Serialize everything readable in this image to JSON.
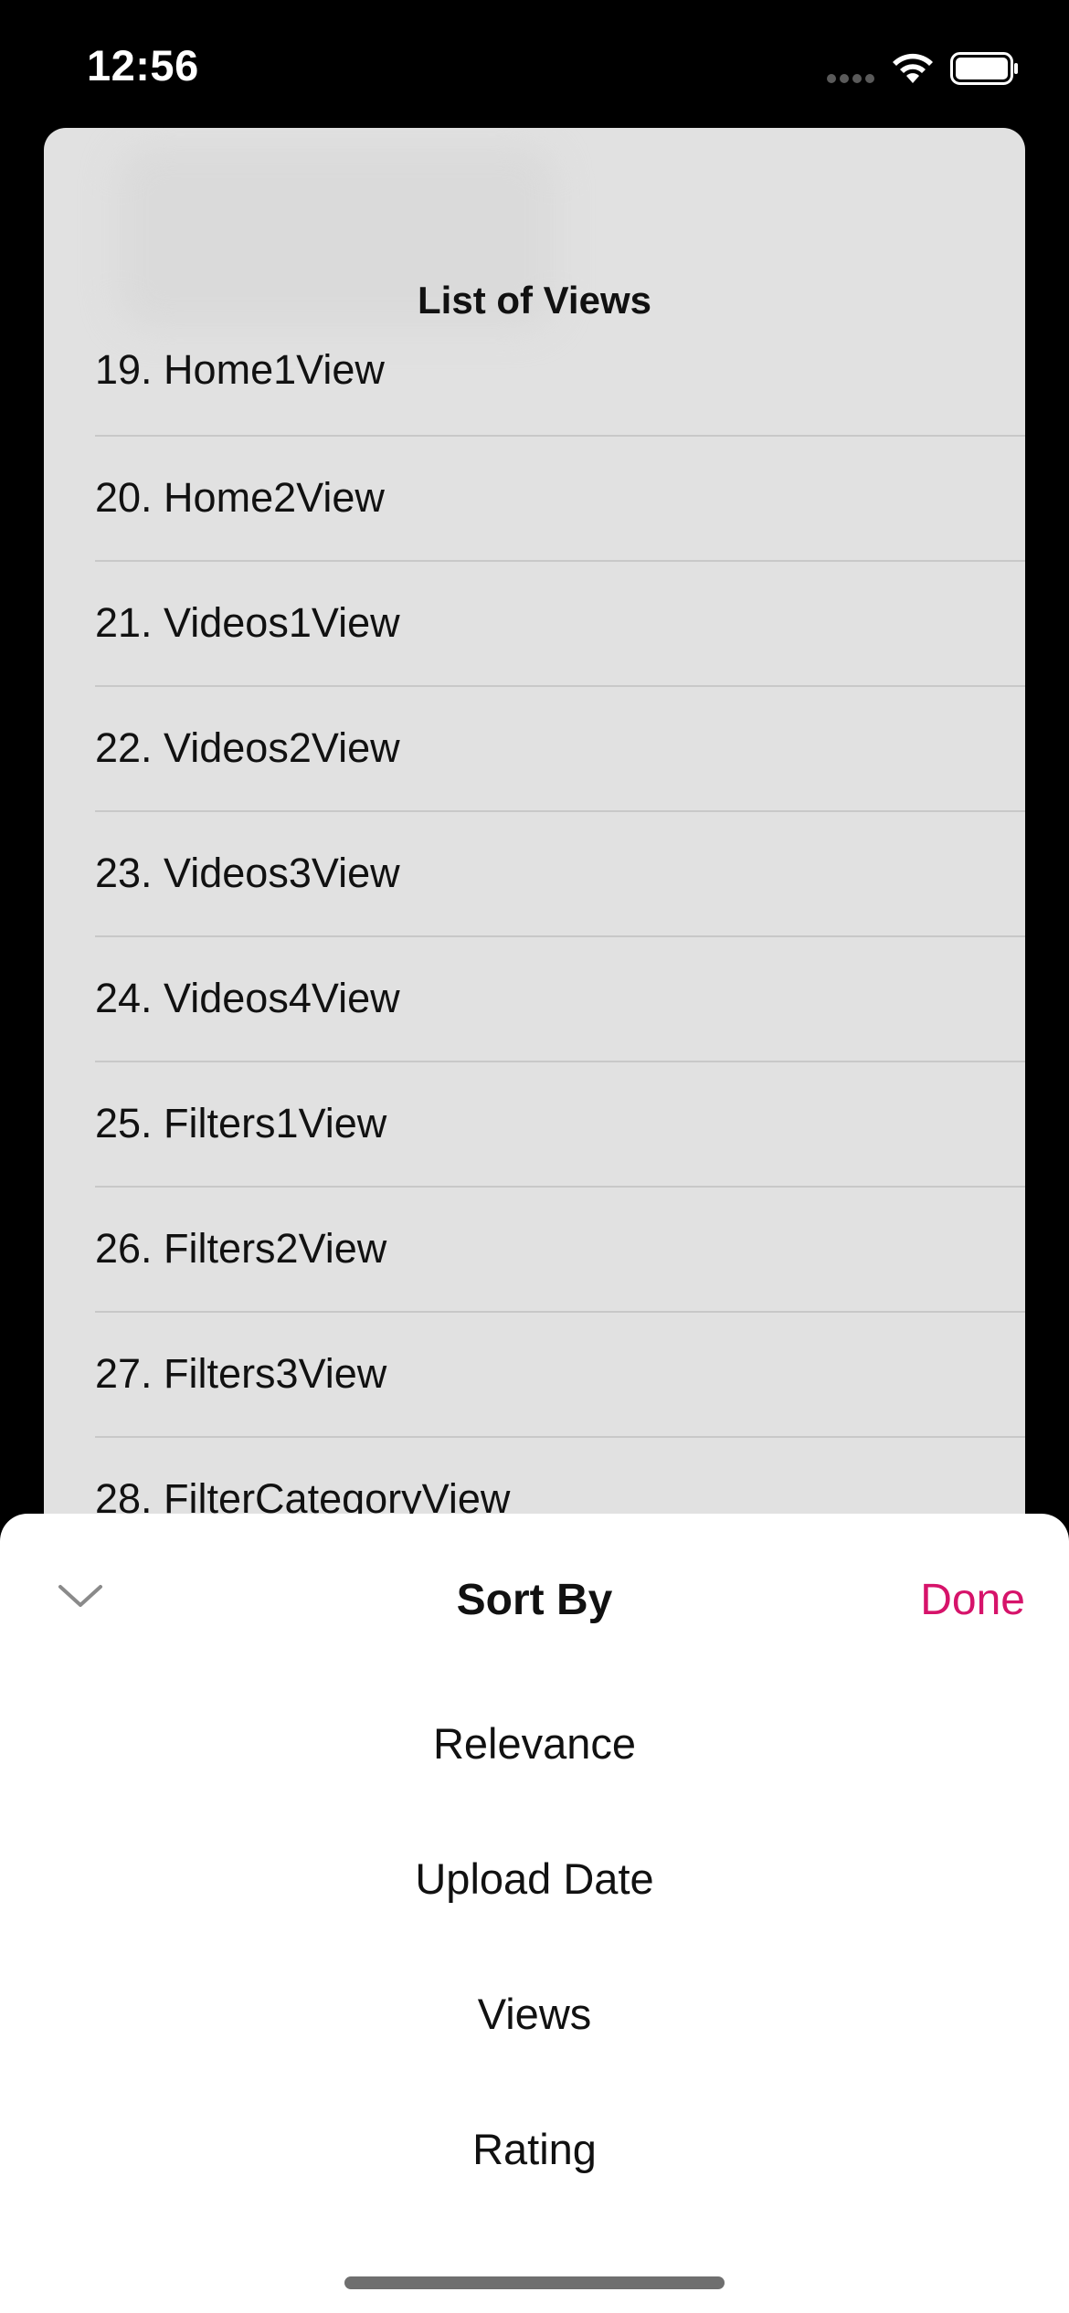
{
  "status_bar": {
    "time": "12:56"
  },
  "background_sheet": {
    "title": "List of Views",
    "items": [
      "19. Home1View",
      "20. Home2View",
      "21. Videos1View",
      "22. Videos2View",
      "23. Videos3View",
      "24. Videos4View",
      "25. Filters1View",
      "26. Filters2View",
      "27. Filters3View",
      "28. FilterCategoryView"
    ]
  },
  "sort_sheet": {
    "title": "Sort By",
    "done_label": "Done",
    "collapse_icon": "chevron-down-icon",
    "accent_color": "#d6136a",
    "options": [
      "Relevance",
      "Upload Date",
      "Views",
      "Rating"
    ]
  }
}
